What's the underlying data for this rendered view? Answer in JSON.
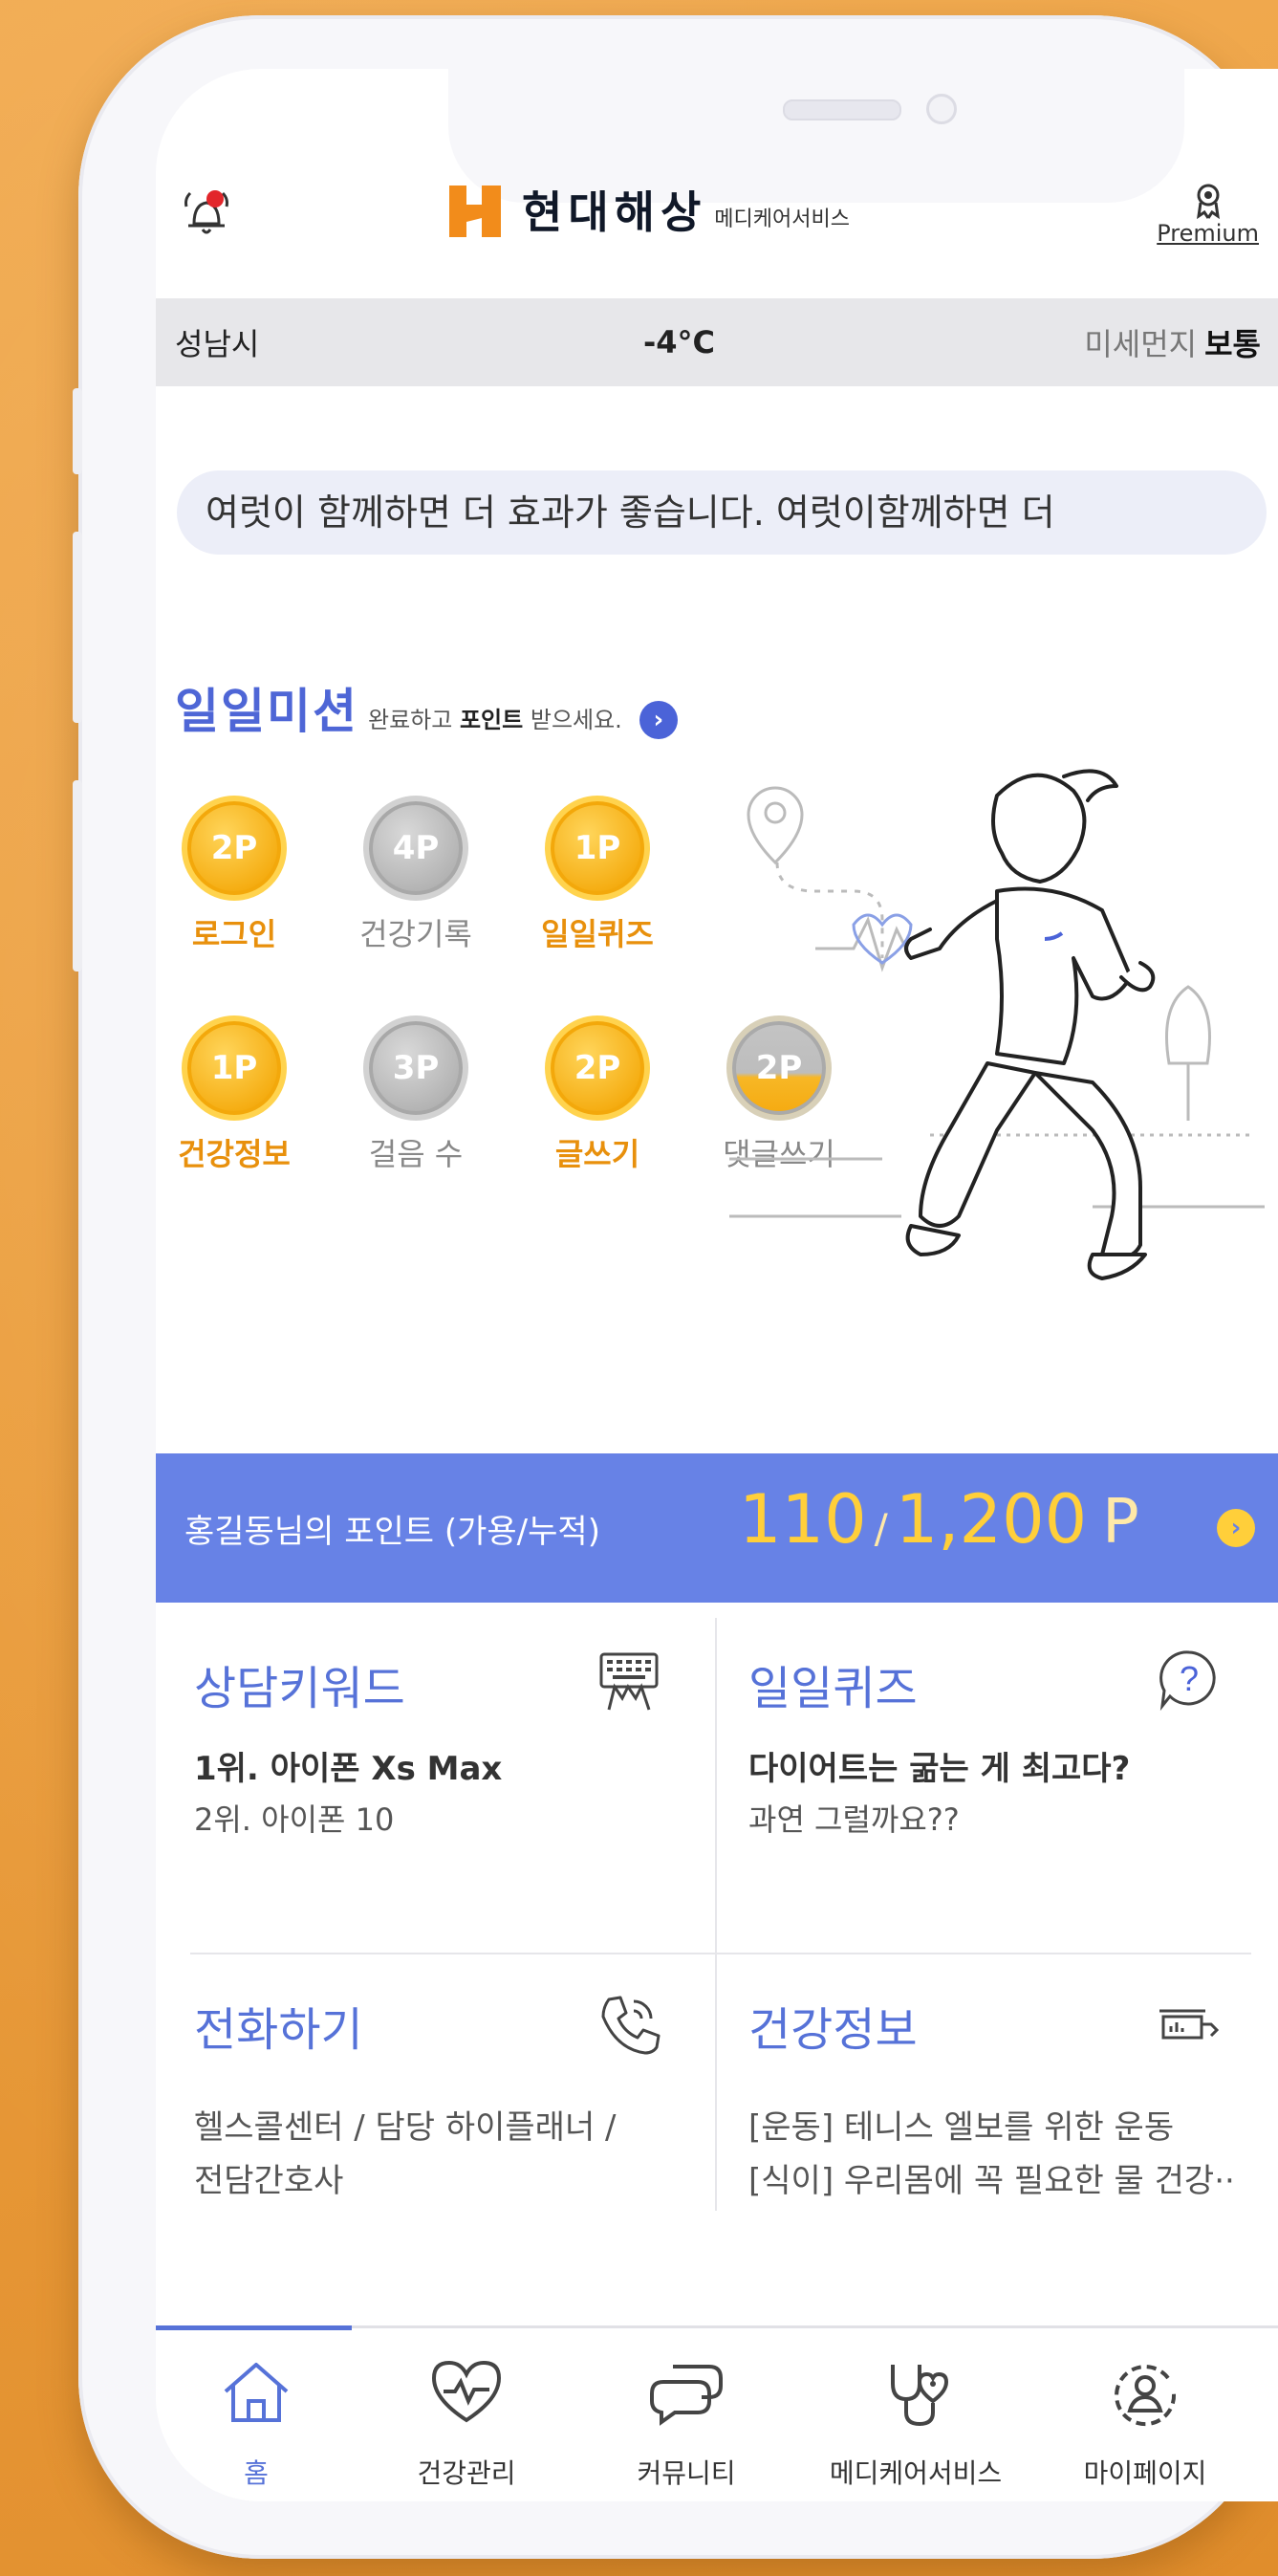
{
  "header": {
    "brand_name": "현대해상",
    "brand_sub": "메디케어서비스",
    "premium_label": "Premium"
  },
  "weather": {
    "city": "성남시",
    "temperature": "-4°C",
    "dust_label": "미세먼지",
    "dust_value": "보통"
  },
  "ticker": {
    "text": "여럿이 함께하면 더 효과가 좋습니다.   여럿이함께하면 더"
  },
  "mission": {
    "title": "일일미션",
    "desc_prefix": "완료하고",
    "desc_bold": "포인트",
    "desc_suffix": "받으세요.",
    "arrow": "›",
    "items": [
      {
        "points": "2P",
        "label": "로그인",
        "state": "done"
      },
      {
        "points": "4P",
        "label": "건강기록",
        "state": "todo"
      },
      {
        "points": "1P",
        "label": "일일퀴즈",
        "state": "done"
      },
      {
        "points": "1P",
        "label": "건강정보",
        "state": "done"
      },
      {
        "points": "3P",
        "label": "걸음 수",
        "state": "todo"
      },
      {
        "points": "2P",
        "label": "글쓰기",
        "state": "done"
      },
      {
        "points": "2P",
        "label": "댓글쓰기",
        "state": "partial"
      }
    ]
  },
  "points": {
    "label": "홍길동님의 포인트 (가용/누적)",
    "available": "110",
    "separator": "/",
    "total": "1,200",
    "unit": "P",
    "arrow": "›"
  },
  "cards": {
    "keyword": {
      "title": "상담키워드",
      "line1": "1위. 아이폰 Xs Max",
      "line2": "2위. 아이폰 10",
      "icon": "keyboard-icon"
    },
    "quiz": {
      "title": "일일퀴즈",
      "line1": "다이어트는 굶는 게 최고다?",
      "line2": "과연 그럴까요??",
      "icon": "question-icon",
      "icon_text": "?"
    },
    "call": {
      "title": "전화하기",
      "line1": "헬스콜센터 / 담당 하이플래너 /",
      "line2": "전담간호사",
      "icon": "phone-icon"
    },
    "health": {
      "title": "건강정보",
      "line1": "[운동] 테니스 엘보를 위한 운동",
      "line2": "[식이] 우리몸에 꼭 필요한 물 건강··",
      "icon": "chart-icon"
    }
  },
  "nav": {
    "items": [
      {
        "label": "홈",
        "icon": "home-icon",
        "active": true
      },
      {
        "label": "건강관리",
        "icon": "heart-pulse-icon",
        "active": false
      },
      {
        "label": "커뮤니티",
        "icon": "chat-icon",
        "active": false
      },
      {
        "label": "메디케어서비스",
        "icon": "stethoscope-icon",
        "active": false
      },
      {
        "label": "마이페이지",
        "icon": "user-icon",
        "active": false
      }
    ]
  },
  "colors": {
    "accent": "#5672d8",
    "points_bar": "#6782e6",
    "gold": "#f5ad12",
    "background": "#eb9e3d"
  }
}
